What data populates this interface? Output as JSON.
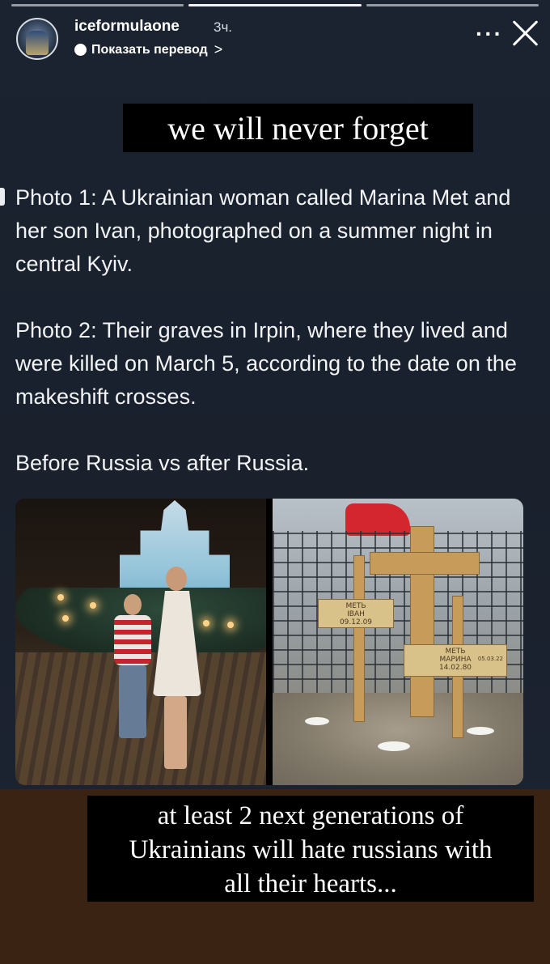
{
  "story": {
    "progress_segments": 3,
    "active_segment": 1
  },
  "header": {
    "username": "iceformulaone",
    "time": "3ч.",
    "translate_label": "Показать перевод",
    "translate_chevron": ">",
    "more_label": "···"
  },
  "headline": "we will never forget",
  "body": {
    "paragraph1": "Photo 1: A Ukrainian woman called Marina Met and her son Ivan, photographed on a summer night in central Kyiv.",
    "paragraph2": "Photo 2: Their graves in Irpin, where they lived and were killed on March 5, according to the date on the makeshift crosses.",
    "paragraph3": "Before Russia vs after Russia."
  },
  "photo2": {
    "plaque1": {
      "line1": "МЕТЬ",
      "line2": "ІВАН",
      "line3": "09.12.09"
    },
    "plaque2": {
      "line1": "МЕТЬ",
      "line2": "МАРИНА",
      "line3": "14.02.80",
      "line4": "05.03.22"
    }
  },
  "caption": {
    "line1": "at least 2 next generations of",
    "line2": "Ukrainians will hate russians with",
    "line3": "all their hearts..."
  },
  "colors": {
    "story_bg": "#1b2230",
    "caption_bg": "#000000",
    "bottom_bg": "#3a2313"
  }
}
